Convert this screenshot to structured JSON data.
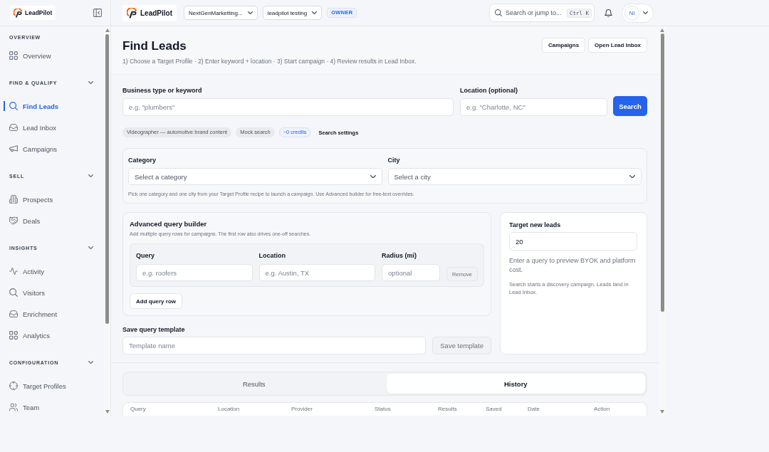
{
  "sidebar": {
    "brand": "LeadPilot",
    "overview": {
      "title": "OVERVIEW",
      "items": [
        {
          "label": "Overview",
          "selected": false
        }
      ]
    },
    "sections": [
      {
        "title": "FIND & QUALIFY",
        "expanded": true,
        "items": [
          {
            "label": "Find Leads",
            "selected": true
          },
          {
            "label": "Lead Inbox",
            "selected": false
          },
          {
            "label": "Campaigns",
            "selected": false
          }
        ]
      },
      {
        "title": "SELL",
        "expanded": true,
        "items": [
          {
            "label": "Prospects",
            "selected": false
          },
          {
            "label": "Deals",
            "selected": false
          }
        ]
      },
      {
        "title": "INSIGHTS",
        "expanded": true,
        "items": [
          {
            "label": "Activity",
            "selected": false
          },
          {
            "label": "Visitors",
            "selected": false
          },
          {
            "label": "Enrichment",
            "selected": false
          },
          {
            "label": "Analytics",
            "selected": false
          }
        ]
      },
      {
        "title": "CONFIGURATION",
        "expanded": true,
        "items": [
          {
            "label": "Target Profiles",
            "selected": false
          },
          {
            "label": "Team",
            "selected": false
          }
        ]
      }
    ]
  },
  "topbar": {
    "brand": "LeadPilot",
    "workspace": "NextGenMarketting...",
    "project": "leadpilot testing",
    "role_badge": "OWNER",
    "search": {
      "placeholder": "Search or jump to...",
      "shortcut": "Ctrl K"
    },
    "avatar": "NI"
  },
  "header": {
    "title": "Find Leads",
    "subtitle": "1) Choose a Target Profile · 2) Enter keyword + location · 3) Start campaign · 4) Review results in Lead Inbox.",
    "buttons": [
      "Campaigns",
      "Open Lead Inbox"
    ]
  },
  "search_form": {
    "keyword": {
      "label": "Business type or keyword",
      "placeholder": "e.g. \"plumbers\""
    },
    "location": {
      "label": "Location (optional)",
      "placeholder": "e.g. \"Charlotte, NC\""
    },
    "button": "Search"
  },
  "chips": [
    {
      "text": "Videographer — automotive brand content",
      "kind": "tag"
    },
    {
      "text": "Mock search",
      "kind": "tag"
    },
    {
      "text": "~0 credits",
      "kind": "credits"
    },
    {
      "text": "Search settings",
      "kind": "link"
    }
  ],
  "recipe": {
    "fields": [
      {
        "label": "Category",
        "placeholder": "Select a category"
      },
      {
        "label": "City",
        "placeholder": "Select a city"
      }
    ],
    "help": "Pick one category and one city from your Target Profile recipe to launch a campaign. Use Advanced builder for free-text overrides."
  },
  "advanced_query": {
    "title": "Advanced query builder",
    "description": "Add multiple query rows for campaigns. The first row also drives one-off searches.",
    "rows": [
      {
        "fields": [
          {
            "label": "Query",
            "placeholder": "e.g. roofers"
          },
          {
            "label": "Location",
            "placeholder": "e.g. Austin, TX"
          },
          {
            "label": "Radius (mi)",
            "placeholder": "optional"
          }
        ],
        "remove_button": {
          "label": "Remove",
          "disabled": true
        }
      }
    ],
    "add_button": "Add query row"
  },
  "save_template": {
    "label": "Save query template",
    "placeholder": "Template name",
    "button": {
      "label": "Save template",
      "disabled": true
    }
  },
  "target": {
    "label": "Target new leads",
    "value": "20",
    "estimate": "Enter a query to preview BYOK and platform cost.",
    "note": "Search starts a discovery campaign. Leads land in Lead Inbox."
  },
  "tabs": [
    {
      "label": "Results",
      "selected": false
    },
    {
      "label": "History",
      "selected": true
    }
  ],
  "table": {
    "columns": [
      "Query",
      "Location",
      "Provider",
      "Status",
      "Results",
      "Saved",
      "Date",
      "Action"
    ]
  }
}
